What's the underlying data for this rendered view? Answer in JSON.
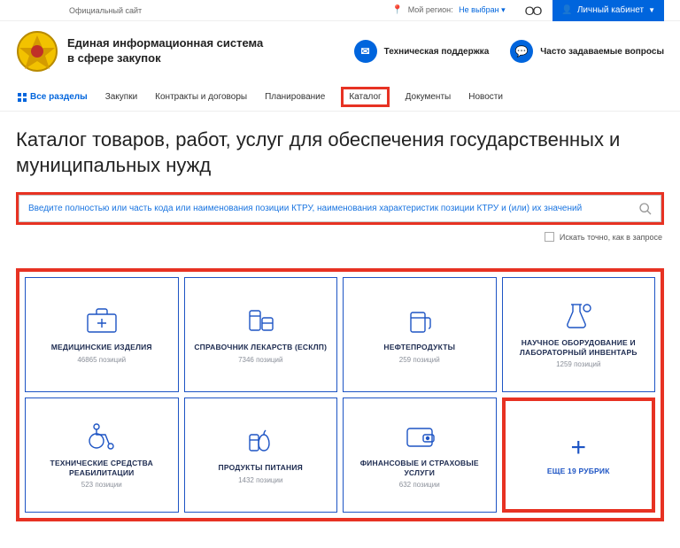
{
  "topbar": {
    "official": "Официальный сайт",
    "region_label": "Мой регион:",
    "region_value": "Не выбран",
    "login": "Личный кабинет"
  },
  "header": {
    "title_l1": "Единая информационная система",
    "title_l2": "в сфере закупок",
    "support": "Техническая поддержка",
    "faq": "Часто задаваемые вопросы"
  },
  "nav": {
    "all": "Все разделы",
    "items": [
      "Закупки",
      "Контракты и договоры",
      "Планирование",
      "Каталог",
      "Документы",
      "Новости"
    ]
  },
  "page": {
    "title": "Каталог товаров, работ, услуг для обеспечения государственных и муниципальных нужд"
  },
  "search": {
    "placeholder": "Введите полностью или часть кода или наименования позиции КТРУ, наименования характеристик позиции КТРУ и (или) их значений",
    "exact": "Искать точно, как в запросе"
  },
  "cards": [
    {
      "label": "МЕДИЦИНСКИЕ ИЗДЕЛИЯ",
      "count": "46865 позиций"
    },
    {
      "label": "СПРАВОЧНИК ЛЕКАРСТВ (ЕСКЛП)",
      "count": "7346 позиций"
    },
    {
      "label": "НЕФТЕПРОДУКТЫ",
      "count": "259 позиций"
    },
    {
      "label": "НАУЧНОЕ ОБОРУДОВАНИЕ И ЛАБОРАТОРНЫЙ ИНВЕНТАРЬ",
      "count": "1259 позиций"
    },
    {
      "label": "ТЕХНИЧЕСКИЕ СРЕДСТВА РЕАБИЛИТАЦИИ",
      "count": "523 позиции"
    },
    {
      "label": "ПРОДУКТЫ ПИТАНИЯ",
      "count": "1432 позиции"
    },
    {
      "label": "ФИНАНСОВЫЕ И СТРАХОВЫЕ УСЛУГИ",
      "count": "632 позиции"
    }
  ],
  "more": {
    "label": "ЕЩЕ 19 РУБРИК"
  }
}
